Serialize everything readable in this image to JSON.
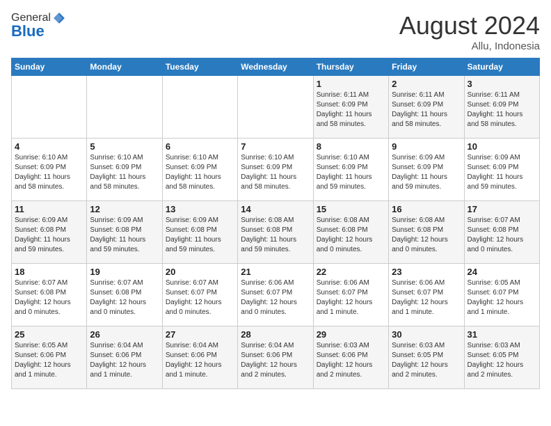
{
  "header": {
    "logo_general": "General",
    "logo_blue": "Blue",
    "month_year": "August 2024",
    "location": "Allu, Indonesia"
  },
  "weekdays": [
    "Sunday",
    "Monday",
    "Tuesday",
    "Wednesday",
    "Thursday",
    "Friday",
    "Saturday"
  ],
  "weeks": [
    [
      {
        "day": "",
        "info": ""
      },
      {
        "day": "",
        "info": ""
      },
      {
        "day": "",
        "info": ""
      },
      {
        "day": "",
        "info": ""
      },
      {
        "day": "1",
        "info": "Sunrise: 6:11 AM\nSunset: 6:09 PM\nDaylight: 11 hours\nand 58 minutes."
      },
      {
        "day": "2",
        "info": "Sunrise: 6:11 AM\nSunset: 6:09 PM\nDaylight: 11 hours\nand 58 minutes."
      },
      {
        "day": "3",
        "info": "Sunrise: 6:11 AM\nSunset: 6:09 PM\nDaylight: 11 hours\nand 58 minutes."
      }
    ],
    [
      {
        "day": "4",
        "info": "Sunrise: 6:10 AM\nSunset: 6:09 PM\nDaylight: 11 hours\nand 58 minutes."
      },
      {
        "day": "5",
        "info": "Sunrise: 6:10 AM\nSunset: 6:09 PM\nDaylight: 11 hours\nand 58 minutes."
      },
      {
        "day": "6",
        "info": "Sunrise: 6:10 AM\nSunset: 6:09 PM\nDaylight: 11 hours\nand 58 minutes."
      },
      {
        "day": "7",
        "info": "Sunrise: 6:10 AM\nSunset: 6:09 PM\nDaylight: 11 hours\nand 58 minutes."
      },
      {
        "day": "8",
        "info": "Sunrise: 6:10 AM\nSunset: 6:09 PM\nDaylight: 11 hours\nand 59 minutes."
      },
      {
        "day": "9",
        "info": "Sunrise: 6:09 AM\nSunset: 6:09 PM\nDaylight: 11 hours\nand 59 minutes."
      },
      {
        "day": "10",
        "info": "Sunrise: 6:09 AM\nSunset: 6:09 PM\nDaylight: 11 hours\nand 59 minutes."
      }
    ],
    [
      {
        "day": "11",
        "info": "Sunrise: 6:09 AM\nSunset: 6:08 PM\nDaylight: 11 hours\nand 59 minutes."
      },
      {
        "day": "12",
        "info": "Sunrise: 6:09 AM\nSunset: 6:08 PM\nDaylight: 11 hours\nand 59 minutes."
      },
      {
        "day": "13",
        "info": "Sunrise: 6:09 AM\nSunset: 6:08 PM\nDaylight: 11 hours\nand 59 minutes."
      },
      {
        "day": "14",
        "info": "Sunrise: 6:08 AM\nSunset: 6:08 PM\nDaylight: 11 hours\nand 59 minutes."
      },
      {
        "day": "15",
        "info": "Sunrise: 6:08 AM\nSunset: 6:08 PM\nDaylight: 12 hours\nand 0 minutes."
      },
      {
        "day": "16",
        "info": "Sunrise: 6:08 AM\nSunset: 6:08 PM\nDaylight: 12 hours\nand 0 minutes."
      },
      {
        "day": "17",
        "info": "Sunrise: 6:07 AM\nSunset: 6:08 PM\nDaylight: 12 hours\nand 0 minutes."
      }
    ],
    [
      {
        "day": "18",
        "info": "Sunrise: 6:07 AM\nSunset: 6:08 PM\nDaylight: 12 hours\nand 0 minutes."
      },
      {
        "day": "19",
        "info": "Sunrise: 6:07 AM\nSunset: 6:08 PM\nDaylight: 12 hours\nand 0 minutes."
      },
      {
        "day": "20",
        "info": "Sunrise: 6:07 AM\nSunset: 6:07 PM\nDaylight: 12 hours\nand 0 minutes."
      },
      {
        "day": "21",
        "info": "Sunrise: 6:06 AM\nSunset: 6:07 PM\nDaylight: 12 hours\nand 0 minutes."
      },
      {
        "day": "22",
        "info": "Sunrise: 6:06 AM\nSunset: 6:07 PM\nDaylight: 12 hours\nand 1 minute."
      },
      {
        "day": "23",
        "info": "Sunrise: 6:06 AM\nSunset: 6:07 PM\nDaylight: 12 hours\nand 1 minute."
      },
      {
        "day": "24",
        "info": "Sunrise: 6:05 AM\nSunset: 6:07 PM\nDaylight: 12 hours\nand 1 minute."
      }
    ],
    [
      {
        "day": "25",
        "info": "Sunrise: 6:05 AM\nSunset: 6:06 PM\nDaylight: 12 hours\nand 1 minute."
      },
      {
        "day": "26",
        "info": "Sunrise: 6:04 AM\nSunset: 6:06 PM\nDaylight: 12 hours\nand 1 minute."
      },
      {
        "day": "27",
        "info": "Sunrise: 6:04 AM\nSunset: 6:06 PM\nDaylight: 12 hours\nand 1 minute."
      },
      {
        "day": "28",
        "info": "Sunrise: 6:04 AM\nSunset: 6:06 PM\nDaylight: 12 hours\nand 2 minutes."
      },
      {
        "day": "29",
        "info": "Sunrise: 6:03 AM\nSunset: 6:06 PM\nDaylight: 12 hours\nand 2 minutes."
      },
      {
        "day": "30",
        "info": "Sunrise: 6:03 AM\nSunset: 6:05 PM\nDaylight: 12 hours\nand 2 minutes."
      },
      {
        "day": "31",
        "info": "Sunrise: 6:03 AM\nSunset: 6:05 PM\nDaylight: 12 hours\nand 2 minutes."
      }
    ]
  ]
}
